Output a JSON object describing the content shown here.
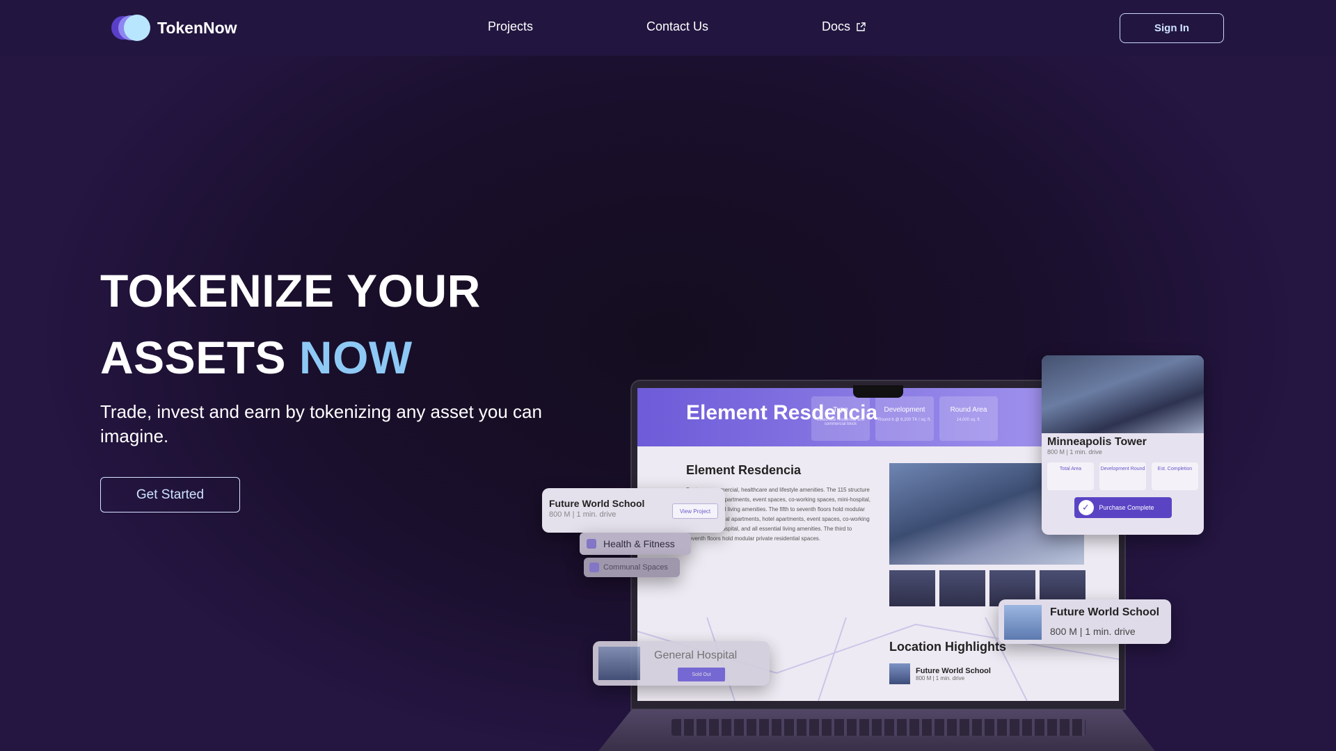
{
  "brand": {
    "name": "TokenNow",
    "colors": {
      "accent": "#8ec9f6",
      "nav_bg": "#221640",
      "primary": "#5a44c4"
    }
  },
  "nav": {
    "links": [
      {
        "label": "Projects"
      },
      {
        "label": "Contact Us"
      },
      {
        "label": "Docs",
        "icon": "external-link-icon"
      }
    ],
    "sign_in": "Sign In"
  },
  "hero": {
    "title_line1": "TOKENIZE YOUR",
    "title_line2_white": "ASSETS",
    "title_line2_accent": "NOW",
    "subtitle": "Trade, invest and earn by tokenizing any asset you can imagine.",
    "cta": "Get Started"
  },
  "mockup": {
    "project_title": "Element Resdencia",
    "stats": [
      {
        "label": "Type",
        "value": "Mixed-use residential and commercial block"
      },
      {
        "label": "Development",
        "value": "Round 6 @ 8,200 TK / sq. ft."
      },
      {
        "label": "Round Area",
        "value": "14,000 sq. ft."
      }
    ],
    "body_title": "Element Resdencia",
    "body_text": "Features commercial, healthcare and lifestyle amenities. The 115 structure includes hotel apartments, event spaces, co-working spaces, mini-hospital, and all essential living amenities. The fifth to seventh floors hold modular private residential apartments, hotel apartments, event spaces, co-working spaces, mini-hospital, and all essential living amenities. The third to seventh floors hold modular private residential spaces.",
    "location_title": "Location Highlights",
    "location_item": {
      "name": "Future World School",
      "sub": "800 M | 1 min. drive"
    }
  },
  "cards": {
    "minneapolis": {
      "name": "Minneapolis Tower",
      "sub": "800 M | 1 min. drive",
      "stats": [
        "Total Area",
        "Development Round",
        "Est. Completion"
      ],
      "button": "Purchase Complete"
    },
    "school_small": {
      "name": "Future World School",
      "sub": "800 M | 1 min. drive",
      "button": "View Project"
    },
    "health": "Health & Fitness",
    "communal": "Communal Spaces",
    "school_large": {
      "name": "Future World School",
      "sub": "800 M | 1 min. drive"
    },
    "hospital": {
      "name": "General Hospital",
      "button": "Sold Out"
    }
  }
}
